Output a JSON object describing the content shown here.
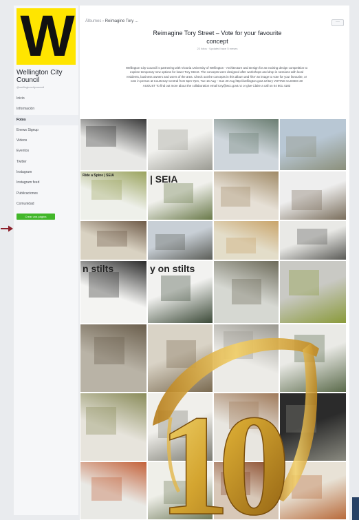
{
  "sidebar": {
    "logo_letter": "W",
    "page_name": "Wellington City Council",
    "page_handle": "@wellingtoncitycouncil",
    "nav": [
      {
        "label": "Inicio",
        "active": false
      },
      {
        "label": "Información",
        "active": false
      },
      {
        "label": "Fotos",
        "active": true
      },
      {
        "label": "Enews Signup",
        "active": false
      },
      {
        "label": "Videos",
        "active": false
      },
      {
        "label": "Eventos",
        "active": false
      },
      {
        "label": "Twitter",
        "active": false
      },
      {
        "label": "Instagram",
        "active": false
      },
      {
        "label": "Instagram feed",
        "active": false
      },
      {
        "label": "Publicaciones",
        "active": false
      },
      {
        "label": "Comunidad",
        "active": false
      }
    ],
    "create_button": "Crear una página"
  },
  "main": {
    "breadcrumb_root": "Álbumes",
    "breadcrumb_sep": "›",
    "breadcrumb_current": "Reimagine Tory ...",
    "more_button": "···",
    "album_title": "Reimagine Tory Street – Vote for your favourite concept",
    "album_meta": "22 fotos · Updated hace 5 meses",
    "album_description": "Wellington City Council is partnering with Victoria University of Wellington - Architecture and Design for an exciting design competition to explore temporary new options for lower Tory Street. The concepts were designed after workshops and drop in sessions with local residents, business owners and users of the area. Check out the concepts in this album and 'like' an image to vote for your favourite, or vote in person at Courtenay Central from 5pm-7pm, Tue 16 Aug – Sun 20 Aug http://wellington.govt.nz/tory VOTING CLOSES 20 AUGUST To find out more about the collaboration email tory@wcc.govt.nz or give Claire a call on 04 801 4183"
  },
  "photos": [
    {
      "label": "",
      "colors": [
        "#e8e8e6",
        "#3a3a3a"
      ]
    },
    {
      "label": "",
      "colors": [
        "#f1f1ee",
        "#9a9a92"
      ]
    },
    {
      "label": "",
      "colors": [
        "#cfd6dc",
        "#6b7e72"
      ]
    },
    {
      "label": "",
      "colors": [
        "#b8c7d4",
        "#8b8f7a"
      ]
    },
    {
      "label": "Ride a Spine | SEIA",
      "colors": [
        "#eef0ea",
        "#9aa35d"
      ]
    },
    {
      "label": "| SEIA",
      "colors": [
        "#f0f0ec",
        "#6a7a4a"
      ]
    },
    {
      "label": "",
      "colors": [
        "#e6e0d6",
        "#a08a66"
      ]
    },
    {
      "label": "",
      "colors": [
        "#eeeeee",
        "#7a6e5c"
      ]
    },
    {
      "label": "",
      "colors": [
        "#d9d2c2",
        "#6e5a48"
      ]
    },
    {
      "label": "",
      "colors": [
        "#c8cfd6",
        "#5c5e58"
      ]
    },
    {
      "label": "",
      "colors": [
        "#e3ddc9",
        "#c9a46a"
      ]
    },
    {
      "label": "",
      "colors": [
        "#e9e9e6",
        "#5a5a56"
      ]
    },
    {
      "label": "n stilts",
      "colors": [
        "#f4f4f2",
        "#2a2a2a"
      ]
    },
    {
      "label": "y on stilts",
      "colors": [
        "#f2f2f0",
        "#3c4a38"
      ]
    },
    {
      "label": "",
      "colors": [
        "#d6d8d2",
        "#6d6b5a"
      ]
    },
    {
      "label": "",
      "colors": [
        "#c9c9c4",
        "#8a9a3a"
      ]
    },
    {
      "label": "",
      "colors": [
        "#b9b3a6",
        "#6a5e4c"
      ]
    },
    {
      "label": "",
      "colors": [
        "#d9d3c6",
        "#7a6a50"
      ]
    },
    {
      "label": "",
      "colors": [
        "#ecebe7",
        "#9a9890"
      ]
    },
    {
      "label": "",
      "colors": [
        "#eaeae6",
        "#5a6a4a"
      ]
    },
    {
      "label": "",
      "colors": [
        "#e7e4dc",
        "#8a8c5a"
      ]
    },
    {
      "label": "",
      "colors": [
        "#f0efeb",
        "#7a7a70"
      ]
    },
    {
      "label": "",
      "colors": [
        "#e8e6e0",
        "#a07a5a"
      ]
    },
    {
      "label": "",
      "colors": [
        "#2b2b2b",
        "#8a8a80"
      ]
    },
    {
      "label": "",
      "colors": [
        "#e9e9e5",
        "#c4623a"
      ]
    },
    {
      "label": "",
      "colors": [
        "#efefe9",
        "#6f7a5a"
      ]
    },
    {
      "label": "",
      "colors": [
        "#d8c8b8",
        "#8a4a2a"
      ]
    },
    {
      "label": "",
      "colors": [
        "#e8e2d6",
        "#b86a3a"
      ]
    }
  ],
  "overlay": {
    "number": "10",
    "gold_color": "#d4a530"
  }
}
